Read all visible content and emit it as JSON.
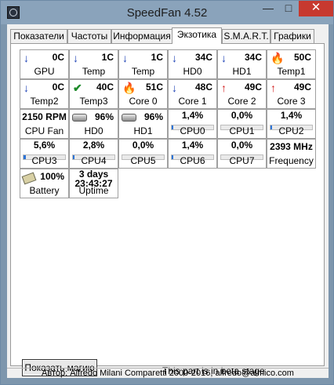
{
  "window": {
    "title": "SpeedFan 4.52"
  },
  "controls": {
    "minimize": "—",
    "maximize": "□",
    "close": "✕"
  },
  "tabs": [
    {
      "label": "Показатели"
    },
    {
      "label": "Частоты"
    },
    {
      "label": "Информация"
    },
    {
      "label": "Экзотика"
    },
    {
      "label": "S.M.A.R.T."
    },
    {
      "label": "Графики"
    }
  ],
  "active_tab": "Экзотика",
  "readings": [
    {
      "icon": "arrow-down-icon",
      "glyph": "↓",
      "value": "0C",
      "label": "GPU"
    },
    {
      "icon": "arrow-down-icon",
      "glyph": "↓",
      "value": "1C",
      "label": "Temp"
    },
    {
      "icon": "arrow-down-icon",
      "glyph": "↓",
      "value": "1C",
      "label": "Temp"
    },
    {
      "icon": "arrow-down-icon",
      "glyph": "↓",
      "value": "34C",
      "label": "HD0"
    },
    {
      "icon": "arrow-down-icon",
      "glyph": "↓",
      "value": "34C",
      "label": "HD1"
    },
    {
      "icon": "flame-icon",
      "glyph": "🔥",
      "value": "50C",
      "label": "Temp1"
    },
    {
      "icon": "arrow-down-icon",
      "glyph": "↓",
      "value": "0C",
      "label": "Temp2"
    },
    {
      "icon": "check-icon",
      "glyph": "✔",
      "value": "40C",
      "label": "Temp3"
    },
    {
      "icon": "flame-icon",
      "glyph": "🔥",
      "value": "51C",
      "label": "Core 0"
    },
    {
      "icon": "arrow-down-icon",
      "glyph": "↓",
      "value": "48C",
      "label": "Core 1"
    },
    {
      "icon": "arrow-up-icon",
      "glyph": "↑",
      "value": "49C",
      "label": "Core 2"
    },
    {
      "icon": "arrow-up-icon",
      "glyph": "↑",
      "value": "49C",
      "label": "Core 3"
    },
    {
      "value": "2150 RPM",
      "label": "CPU Fan"
    },
    {
      "icon": "hdd-icon",
      "value": "96%",
      "label": "HD0"
    },
    {
      "icon": "hdd-icon",
      "value": "96%",
      "label": "HD1"
    },
    {
      "value": "1,4%",
      "label": "CPU0",
      "load": 0.014
    },
    {
      "value": "0,0%",
      "label": "CPU1",
      "load": 0.0
    },
    {
      "value": "1,4%",
      "label": "CPU2",
      "load": 0.014
    },
    {
      "value": "5,6%",
      "label": "CPU3",
      "load": 0.056
    },
    {
      "value": "2,8%",
      "label": "CPU4",
      "load": 0.028
    },
    {
      "value": "0,0%",
      "label": "CPU5",
      "load": 0.0
    },
    {
      "value": "1,4%",
      "label": "CPU6",
      "load": 0.014
    },
    {
      "value": "0,0%",
      "label": "CPU7",
      "load": 0.0
    },
    {
      "value": "2393 MHz",
      "label": "Frequency"
    },
    {
      "icon": "battery-icon",
      "value": "100%",
      "label": "Battery"
    },
    {
      "value": "3 days\n23:43:27",
      "label": "Uptime"
    }
  ],
  "footer": {
    "magic_button": "Показать магию",
    "beta_note": "This part is in beta stage",
    "status": "Автор: Alfredo Milani Comparetti 2000-2016, alfredo@almico.com"
  },
  "colors": {
    "bar_fill": "#2b73d6",
    "close_button": "#c7392f",
    "arrow_down": "#1b3fb4",
    "arrow_up": "#d11c1c",
    "check": "#1d8a2a"
  }
}
